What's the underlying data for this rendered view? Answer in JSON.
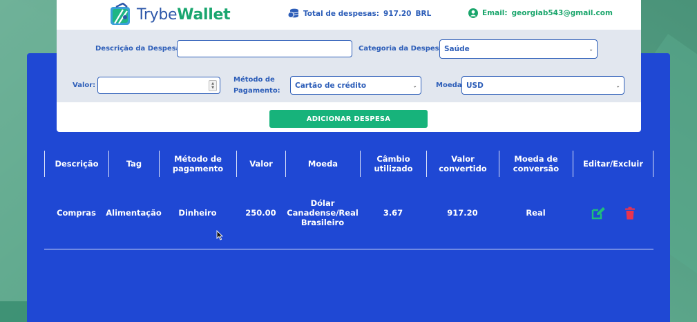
{
  "header": {
    "brand_trybe": "Trybe",
    "brand_wallet": "Wallet",
    "total_label": "Total de despesas:",
    "total_value": "917.20",
    "total_currency": "BRL",
    "email_label": "Email:",
    "email_value": "georgiab543@gmail.com"
  },
  "form": {
    "description_label": "Descrição da Despesa:",
    "description_value": "",
    "category_label": "Categoria da Despesa:",
    "category_value": "Saúde",
    "value_label": "Valor:",
    "value_value": "",
    "method_label_line1": "Método de",
    "method_label_line2": "Pagamento:",
    "method_value": "Cartão de crédito",
    "currency_label": "Moeda:",
    "currency_value": "USD",
    "add_button_label": "ADICIONAR DESPESA"
  },
  "table": {
    "headers": [
      "Descrição",
      "Tag",
      "Método de pagamento",
      "Valor",
      "Moeda",
      "Câmbio utilizado",
      "Valor convertido",
      "Moeda de conversão",
      "Editar/Excluir"
    ],
    "rows": [
      {
        "description": "Compras",
        "tag": "Alimentação",
        "method": "Dinheiro",
        "value": "250.00",
        "currency": "Dólar Canadense/Real Brasileiro",
        "rate": "3.67",
        "converted": "917.20",
        "conversion_currency": "Real"
      }
    ]
  },
  "icons": {
    "logo": "wallet-logo-icon",
    "coins": "coins-icon",
    "user": "user-circle-icon",
    "edit": "edit-icon",
    "delete": "trash-icon"
  },
  "colors": {
    "brand_blue": "#2c5db8",
    "brand_green": "#19a56b",
    "panel_blue": "#1f48d4",
    "button_green": "#17b37b",
    "edit_green": "#1fbf7a",
    "delete_red": "#e8334f"
  }
}
